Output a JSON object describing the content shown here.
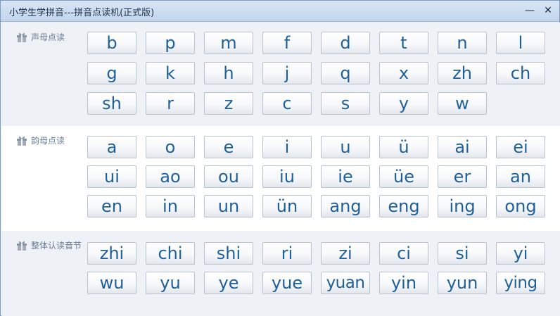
{
  "window": {
    "title": "小学生学拼音---拼音点读机(正式版)",
    "minimize_label": "—",
    "close_label": "✕"
  },
  "colors": {
    "key_text": "#1f5f9a",
    "label_text": "#6a7d95",
    "titlebar": "#c2d5ec"
  },
  "sections": [
    {
      "label": "声母点读",
      "icon": "gift-icon",
      "keys": [
        "b",
        "p",
        "m",
        "f",
        "d",
        "t",
        "n",
        "l",
        "g",
        "k",
        "h",
        "j",
        "q",
        "x",
        "zh",
        "ch",
        "sh",
        "r",
        "z",
        "c",
        "s",
        "y",
        "w"
      ]
    },
    {
      "label": "韵母点读",
      "icon": "gift-icon",
      "keys": [
        "a",
        "o",
        "e",
        "i",
        "u",
        "ü",
        "ai",
        "ei",
        "ui",
        "ao",
        "ou",
        "iu",
        "ie",
        "üe",
        "er",
        "an",
        "en",
        "in",
        "un",
        "ün",
        "ang",
        "eng",
        "ing",
        "ong"
      ]
    },
    {
      "label": "整体认读音节",
      "icon": "gift-icon",
      "keys": [
        "zhi",
        "chi",
        "shi",
        "ri",
        "zi",
        "ci",
        "si",
        "yi",
        "wu",
        "yu",
        "ye",
        "yue",
        "yuan",
        "yin",
        "yun",
        "ying"
      ]
    }
  ]
}
